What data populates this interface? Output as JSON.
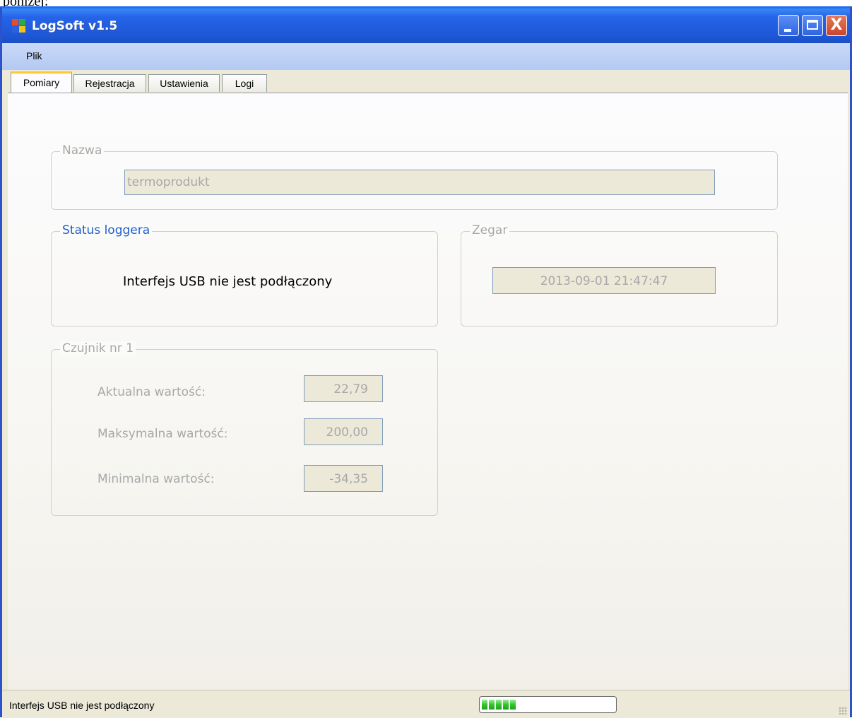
{
  "page_fragment": "poniżej:",
  "window": {
    "title": "LogSoft v1.5",
    "icon": "app-icon",
    "controls": {
      "minimize_icon": "minimize-icon",
      "maximize_icon": "maximize-icon",
      "close_icon": "close-icon",
      "close_glyph": "X"
    }
  },
  "menu": {
    "items": [
      {
        "label": "Plik"
      }
    ]
  },
  "tabs": [
    {
      "label": "Pomiary",
      "active": true
    },
    {
      "label": "Rejestracja",
      "active": false
    },
    {
      "label": "Ustawienia",
      "active": false
    },
    {
      "label": "Logi",
      "active": false
    }
  ],
  "nazwa": {
    "legend": "Nazwa",
    "value": "termoprodukt"
  },
  "status_loggera": {
    "legend": "Status loggera",
    "message": "Interfejs USB nie jest podłączony"
  },
  "zegar": {
    "legend": "Zegar",
    "value": "2013-09-01 21:47:47"
  },
  "czujnik": {
    "legend": "Czujnik nr 1",
    "rows": [
      {
        "label": "Aktualna wartość:",
        "value": "22,79"
      },
      {
        "label": "Maksymalna wartość:",
        "value": "200,00"
      },
      {
        "label": "Minimalna wartość:",
        "value": "-34,35"
      }
    ]
  },
  "statusbar": {
    "text": "Interfejs USB nie jest podłączony",
    "progress_blocks": 5
  },
  "colors": {
    "titlebar": "#2563e8",
    "accent_tab": "#ffc83c",
    "legend_blue": "#1e5ccc",
    "disabled_text": "#a8a8a8"
  }
}
